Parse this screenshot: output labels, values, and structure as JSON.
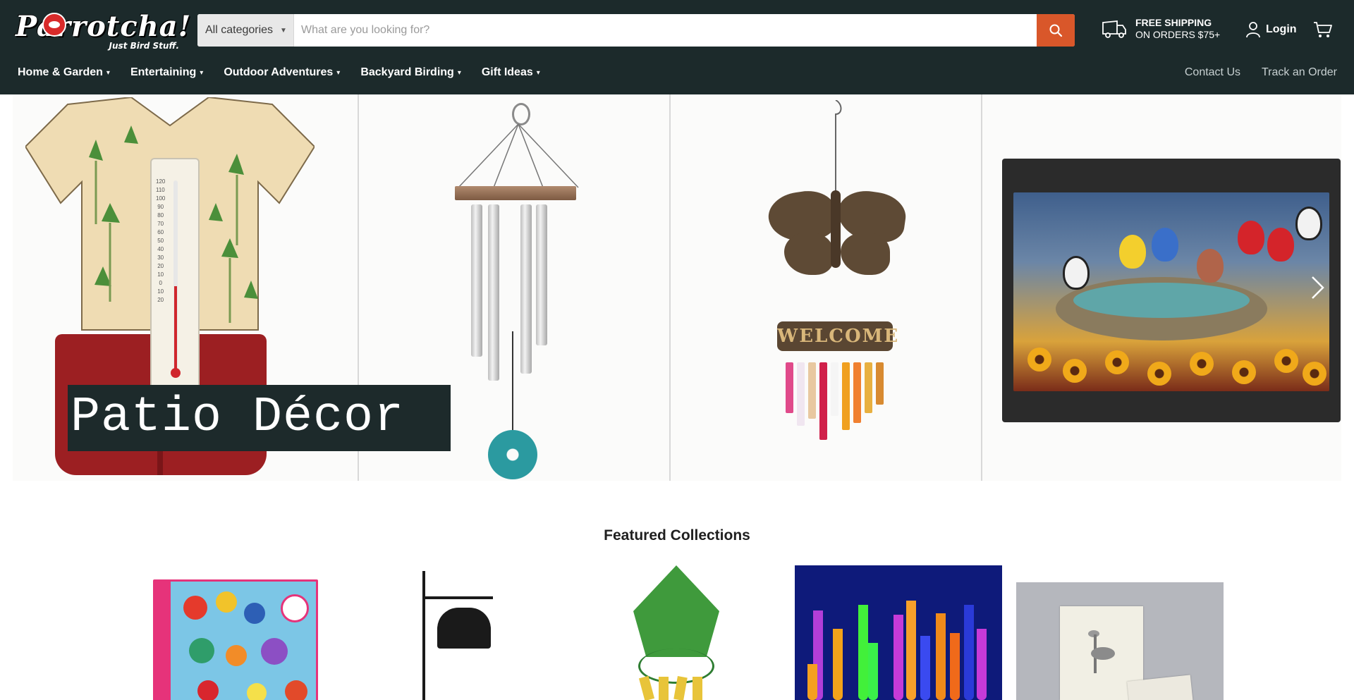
{
  "header": {
    "logo_text": "Parrotcha!",
    "logo_tagline": "Just Bird Stuff.",
    "search": {
      "category_label": "All categories",
      "placeholder": "What are you looking for?",
      "value": ""
    },
    "shipping": {
      "line1": "FREE SHIPPING",
      "line2": "ON ORDERS $75+"
    },
    "login_label": "Login"
  },
  "nav": {
    "items": [
      {
        "label": "Home & Garden"
      },
      {
        "label": "Entertaining"
      },
      {
        "label": "Outdoor Adventures"
      },
      {
        "label": "Backyard Birding"
      },
      {
        "label": "Gift Ideas"
      }
    ],
    "right": [
      {
        "label": "Contact Us"
      },
      {
        "label": "Track an Order"
      }
    ]
  },
  "hero": {
    "label": "Patio Décor",
    "welcome_sign": "WELCOME"
  },
  "featured": {
    "title": "Featured Collections"
  },
  "colors": {
    "header_bg": "#1c2a2b",
    "search_button": "#d9572a",
    "hero_label_bg": "#1d2a2b"
  },
  "icons": {
    "search": "search-icon",
    "truck": "truck-icon",
    "user": "user-icon",
    "cart": "cart-icon",
    "next": "chevron-right-icon"
  }
}
